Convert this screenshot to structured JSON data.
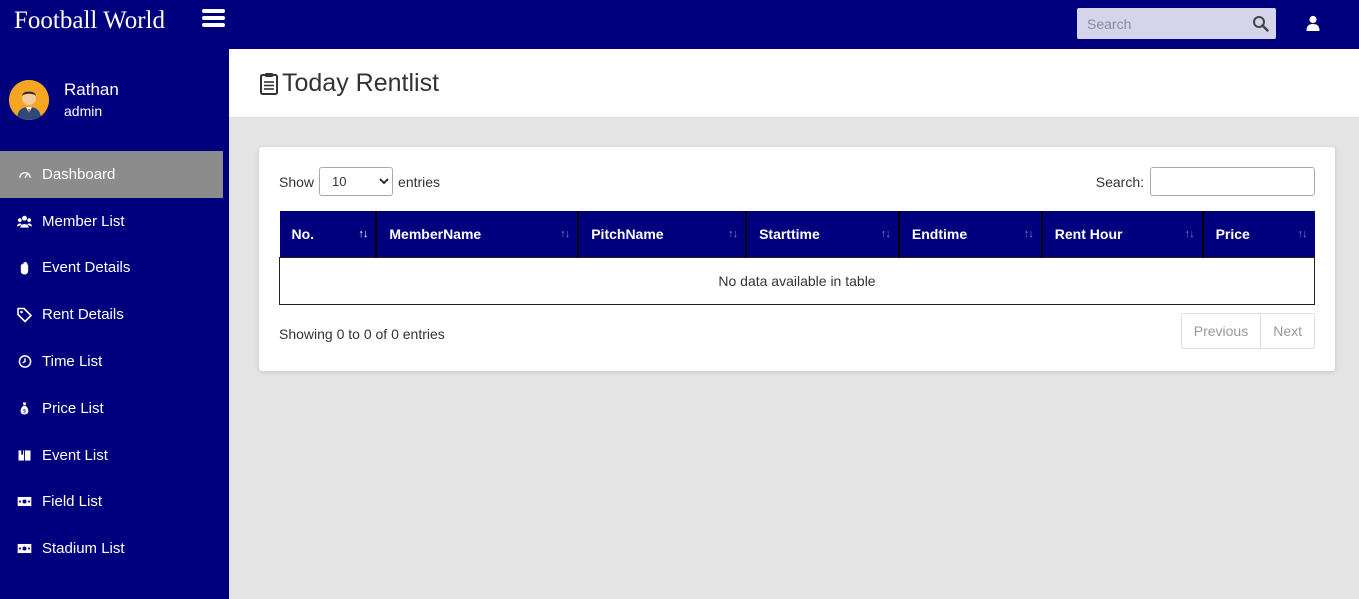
{
  "app": {
    "brand": "Football World",
    "colors": {
      "primary": "#00007f",
      "active_nav": "#8c8c8c",
      "avatar_bg": "#f6a623"
    }
  },
  "topbar": {
    "search_placeholder": "Search",
    "icons": {
      "menu": "hamburger-icon",
      "search": "magnifier-icon",
      "user": "user-icon"
    }
  },
  "profile": {
    "name": "Rathan",
    "role": "admin"
  },
  "sidebar": {
    "items": [
      {
        "label": "Dashboard",
        "icon": "dashboard-gauge-icon",
        "active": true
      },
      {
        "label": "Member List",
        "icon": "users-icon",
        "active": false
      },
      {
        "label": "Event Details",
        "icon": "hand-icon",
        "active": false
      },
      {
        "label": "Rent Details",
        "icon": "tag-icon",
        "active": false
      },
      {
        "label": "Time List",
        "icon": "clock-icon",
        "active": false
      },
      {
        "label": "Price List",
        "icon": "money-bag-icon",
        "active": false
      },
      {
        "label": "Event List",
        "icon": "book-icon",
        "active": false
      },
      {
        "label": "Field List",
        "icon": "money-bill-icon",
        "active": false
      },
      {
        "label": "Stadium List",
        "icon": "money-bill-icon",
        "active": false
      }
    ]
  },
  "page": {
    "title": "Today Rentlist",
    "title_icon": "clipboard-list-icon"
  },
  "table": {
    "length_label_before": "Show",
    "length_value": "10",
    "length_label_after": "entries",
    "search_label": "Search:",
    "search_value": "",
    "columns": [
      "No.",
      "MemberName",
      "PitchName",
      "Starttime",
      "Endtime",
      "Rent Hour",
      "Price"
    ],
    "empty_message": "No data available in table",
    "info": "Showing 0 to 0 of 0 entries",
    "pagination": {
      "previous": "Previous",
      "next": "Next"
    }
  }
}
